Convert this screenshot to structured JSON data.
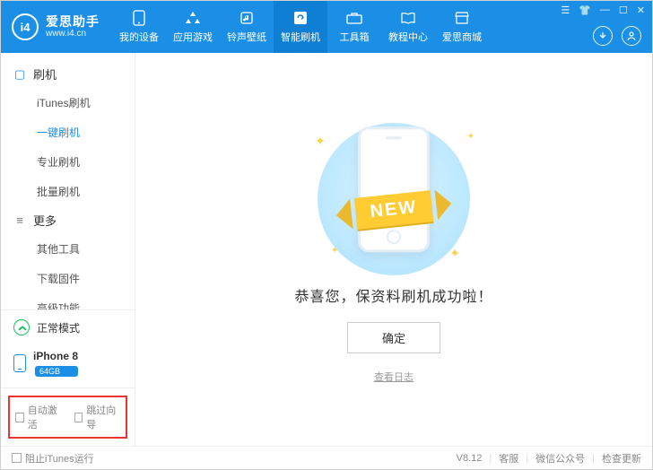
{
  "app": {
    "name": "爱思助手",
    "url": "www.i4.cn"
  },
  "nav": [
    {
      "label": "我的设备",
      "icon": "phone"
    },
    {
      "label": "应用游戏",
      "icon": "apps"
    },
    {
      "label": "铃声壁纸",
      "icon": "music"
    },
    {
      "label": "智能刷机",
      "icon": "flash",
      "active": true
    },
    {
      "label": "工具箱",
      "icon": "toolbox"
    },
    {
      "label": "教程中心",
      "icon": "book"
    },
    {
      "label": "爱思商城",
      "icon": "store"
    }
  ],
  "sidebar": {
    "section_flash": {
      "title": "刷机",
      "items": [
        {
          "label": "iTunes刷机"
        },
        {
          "label": "一键刷机",
          "active": true
        },
        {
          "label": "专业刷机"
        },
        {
          "label": "批量刷机"
        }
      ]
    },
    "section_more": {
      "title": "更多",
      "items": [
        {
          "label": "其他工具"
        },
        {
          "label": "下载固件"
        },
        {
          "label": "高级功能"
        }
      ]
    },
    "mode": "正常模式",
    "device": {
      "name": "iPhone 8",
      "storage": "64GB"
    },
    "checks": {
      "auto_activate": "自动激活",
      "skip_guide": "跳过向导"
    }
  },
  "main": {
    "ribbon": "NEW",
    "success": "恭喜您，保资料刷机成功啦！",
    "ok": "确定",
    "view_log": "查看日志"
  },
  "footer": {
    "block_itunes": "阻止iTunes运行",
    "version": "V8.12",
    "support": "客服",
    "wechat": "微信公众号",
    "check_update": "检查更新"
  }
}
